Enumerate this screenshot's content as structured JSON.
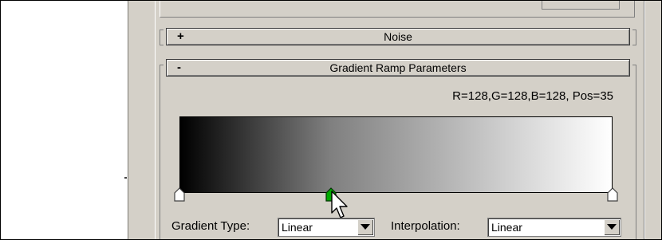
{
  "rollouts": {
    "noise": {
      "sign": "+",
      "title": "Noise"
    },
    "gradient_ramp": {
      "sign": "-",
      "title": "Gradient Ramp Parameters"
    }
  },
  "readout": "R=128,G=128,B=128, Pos=35",
  "ramp": {
    "colors": [
      "#000000",
      "#808080",
      "#ffffff"
    ],
    "flags": [
      {
        "pos": 0,
        "color": "#ffffff",
        "selected": false
      },
      {
        "pos": 35,
        "color": "#00aa00",
        "selected": true
      },
      {
        "pos": 100,
        "color": "#ffffff",
        "selected": false
      }
    ]
  },
  "gradient_type": {
    "label": "Gradient Type:",
    "value": "Linear"
  },
  "interpolation": {
    "label": "Interpolation:",
    "value": "Linear"
  }
}
